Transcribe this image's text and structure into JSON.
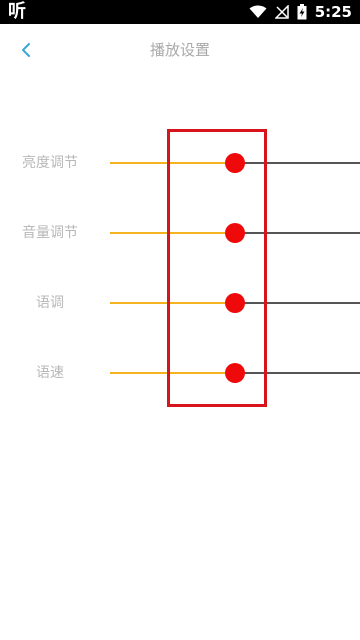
{
  "status_bar": {
    "app_label": "听",
    "time": "5:25",
    "icons": [
      "wifi-icon",
      "no-signal-icon",
      "battery-charging-icon"
    ]
  },
  "header": {
    "title": "播放设置",
    "back_icon": "chevron-left-icon",
    "accent_color": "#3aa7d6"
  },
  "settings": [
    {
      "label": "亮度调节",
      "value_fraction": 0.5
    },
    {
      "label": "音量调节",
      "value_fraction": 0.5
    },
    {
      "label": "语调",
      "value_fraction": 0.5
    },
    {
      "label": "语速",
      "value_fraction": 0.5
    }
  ],
  "colors": {
    "track_filled": "#f3b420",
    "track_rest": "#555555",
    "thumb": "#ee0a0a",
    "highlight_box": "#d7141a"
  }
}
